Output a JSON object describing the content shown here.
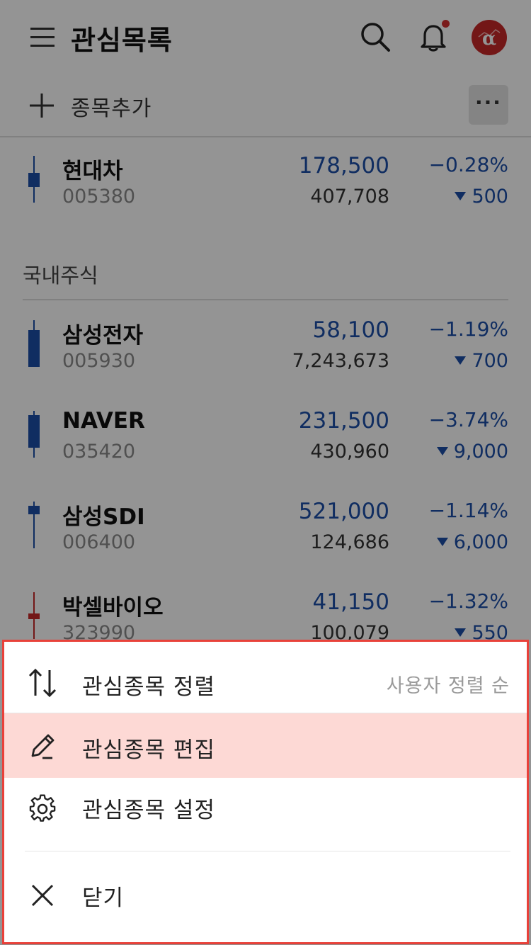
{
  "header": {
    "title": "관심목록",
    "menu_icon": "hamburger-menu-icon",
    "search_icon": "search-icon",
    "bell_icon": "bell-icon",
    "avatar_letter": "α",
    "notification_dot_color": "#d32f2f",
    "avatar_color": "#c62828"
  },
  "addbar": {
    "add_label": "종목추가",
    "more_label": "···"
  },
  "colors": {
    "down_blue": "#1c4fa8",
    "up_red": "#c62828",
    "highlight": "#fdd9d5",
    "sheet_border": "#e8413a"
  },
  "top_stock": {
    "name": "현대차",
    "code": "005380",
    "price": "178,500",
    "volume": "407,708",
    "rate": "−0.28%",
    "change": "500",
    "direction": "down"
  },
  "section": {
    "title": "국내주식"
  },
  "stocks": [
    {
      "name": "삼성전자",
      "code": "005930",
      "price": "58,100",
      "volume": "7,243,673",
      "rate": "−1.19%",
      "change": "700",
      "direction": "down"
    },
    {
      "name": "NAVER",
      "code": "035420",
      "price": "231,500",
      "volume": "430,960",
      "rate": "−3.74%",
      "change": "9,000",
      "direction": "down"
    },
    {
      "name": "삼성SDI",
      "code": "006400",
      "price": "521,000",
      "volume": "124,686",
      "rate": "−1.14%",
      "change": "6,000",
      "direction": "down"
    },
    {
      "name": "박셀바이오",
      "code": "323990",
      "price": "41,150",
      "volume": "100,079",
      "rate": "−1.32%",
      "change": "550",
      "direction": "down"
    }
  ],
  "sheet": {
    "items": [
      {
        "label": "관심종목 정렬",
        "value": "사용자 정렬 순",
        "icon": "sort-arrows-icon"
      },
      {
        "label": "관심종목 편집",
        "value": "",
        "icon": "pencil-icon",
        "highlighted": true
      },
      {
        "label": "관심종목 설정",
        "value": "",
        "icon": "gear-icon"
      },
      {
        "label": "닫기",
        "value": "",
        "icon": "close-icon"
      }
    ]
  }
}
